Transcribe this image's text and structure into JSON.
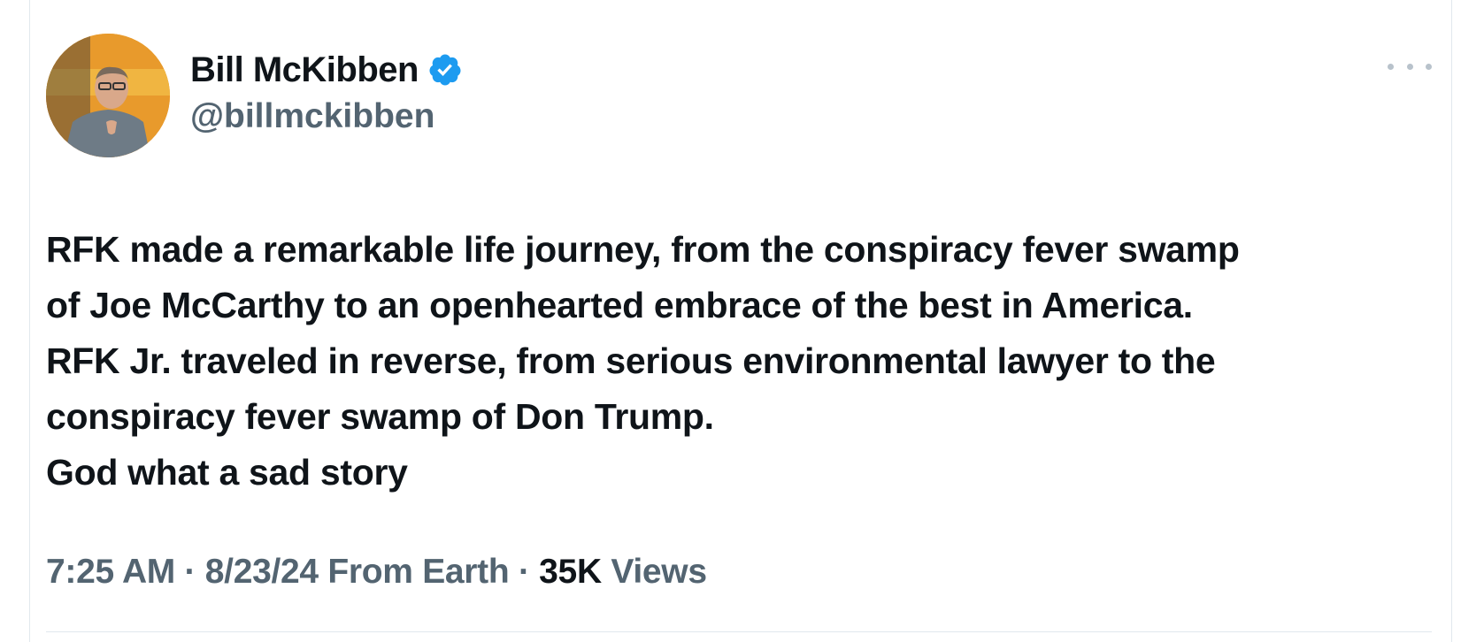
{
  "author": {
    "display_name": "Bill McKibben",
    "handle": "@billmckibben",
    "verified": true,
    "verified_color": "#1d9bf0"
  },
  "menu": {
    "icon": "more-horizontal-icon"
  },
  "tweet": {
    "lines": [
      "RFK made a remarkable life journey, from the conspiracy fever swamp",
      "of Joe McCarthy to an openhearted embrace of the best in America.",
      "RFK Jr. traveled in reverse, from serious environmental lawyer to the",
      "conspiracy fever swamp of Don Trump.",
      "God what a sad story"
    ]
  },
  "meta": {
    "time": "7:25 AM",
    "date": "8/23/24",
    "source": "From Earth",
    "views_count": "35K",
    "views_label": "Views",
    "separator": "·"
  },
  "colors": {
    "text_primary": "#0f1419",
    "text_secondary": "#536471",
    "border": "#e1e8ed"
  }
}
